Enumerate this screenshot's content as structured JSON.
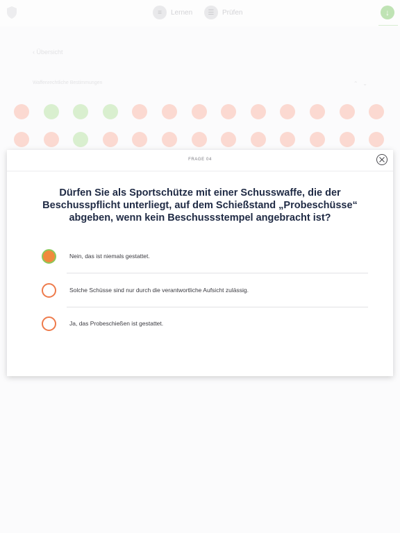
{
  "nav": {
    "learn_label": "Lernen",
    "test_label": "Prüfen"
  },
  "background": {
    "back_label": "Übersicht",
    "category_label": "Waffenrechtliche Bestimmungen",
    "questions": [
      {
        "status": "wrong"
      },
      {
        "status": "right"
      },
      {
        "status": "right"
      },
      {
        "status": "right"
      },
      {
        "status": "wrong"
      },
      {
        "status": "wrong"
      },
      {
        "status": "wrong"
      },
      {
        "status": "wrong"
      },
      {
        "status": "wrong"
      },
      {
        "status": "wrong"
      },
      {
        "status": "wrong"
      },
      {
        "status": "wrong"
      },
      {
        "status": "wrong"
      },
      {
        "status": "wrong"
      },
      {
        "status": "wrong"
      },
      {
        "status": "right"
      },
      {
        "status": "wrong"
      },
      {
        "status": "wrong"
      },
      {
        "status": "wrong"
      },
      {
        "status": "wrong"
      },
      {
        "status": "wrong"
      },
      {
        "status": "wrong"
      },
      {
        "status": "wrong"
      },
      {
        "status": "wrong"
      },
      {
        "status": "wrong"
      },
      {
        "status": "wrong"
      }
    ]
  },
  "modal": {
    "label": "FRAGE 04",
    "question": "Dürfen Sie als Sportschütze mit einer Schusswaffe, die der Beschusspflicht unterliegt, auf dem Schießstand „Probeschüsse“ abgeben, wenn kein Beschussstempel angebracht ist?",
    "answers": [
      {
        "text": "Nein, das ist niemals gestattet.",
        "selected": true
      },
      {
        "text": "Solche Schüsse sind nur durch die verantwortliche Aufsicht zulässig.",
        "selected": false
      },
      {
        "text": "Ja, das Probeschießen ist gestattet.",
        "selected": false
      }
    ]
  },
  "colors": {
    "accent_orange": "#ee7a4a",
    "selected_fill": "#f08a3c",
    "selected_ring": "#8cc85a",
    "question_text": "#1f2a44",
    "wrong_bubble": "#fbd9d1",
    "right_bubble": "#d9efcf"
  },
  "icons": {
    "logo": "shield-logo",
    "learn": "book-icon",
    "test": "checklist-icon",
    "profile": "user-download-icon",
    "close": "close-icon"
  }
}
